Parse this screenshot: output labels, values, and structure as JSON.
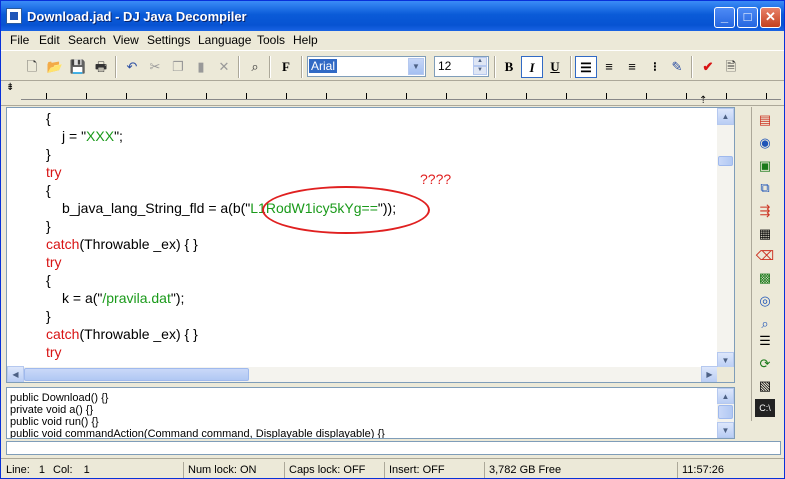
{
  "window": {
    "title": "Download.jad - DJ Java Decompiler"
  },
  "titlebar": {
    "minimize": "_",
    "maximize": "□",
    "close": "✕"
  },
  "menu": [
    "File",
    "Edit",
    "Search",
    "View",
    "Settings",
    "Language",
    "Tools",
    "Help"
  ],
  "toolbar": {
    "font_name": "Arial",
    "font_size": "12",
    "font_button": "F",
    "bold": "B",
    "italic": "I",
    "underline": "U"
  },
  "code": {
    "lines": [
      {
        "parts": [
          {
            "t": "{",
            "c": ""
          }
        ],
        "indent": 1
      },
      {
        "parts": [
          {
            "t": "j = \"",
            "c": ""
          },
          {
            "t": "XXX",
            "c": "str"
          },
          {
            "t": "\";",
            "c": ""
          }
        ],
        "indent": 2
      },
      {
        "parts": [
          {
            "t": "}",
            "c": ""
          }
        ],
        "indent": 1
      },
      {
        "parts": [
          {
            "t": "try",
            "c": "kw"
          }
        ],
        "indent": 1
      },
      {
        "parts": [
          {
            "t": "{",
            "c": ""
          }
        ],
        "indent": 1
      },
      {
        "parts": [
          {
            "t": "b_java_lang_String_fld = a(b(\"",
            "c": ""
          },
          {
            "t": "L1RodW1icy5kYg==",
            "c": "str"
          },
          {
            "t": "\"));",
            "c": ""
          }
        ],
        "indent": 2
      },
      {
        "parts": [
          {
            "t": "}",
            "c": ""
          }
        ],
        "indent": 1
      },
      {
        "parts": [
          {
            "t": "catch",
            "c": "kw"
          },
          {
            "t": "(Throwable _ex) { }",
            "c": ""
          }
        ],
        "indent": 1
      },
      {
        "parts": [
          {
            "t": "try",
            "c": "kw"
          }
        ],
        "indent": 1
      },
      {
        "parts": [
          {
            "t": "{",
            "c": ""
          }
        ],
        "indent": 1
      },
      {
        "parts": [
          {
            "t": "k = a(\"",
            "c": ""
          },
          {
            "t": "/pravila.dat",
            "c": "str"
          },
          {
            "t": "\");",
            "c": ""
          }
        ],
        "indent": 2
      },
      {
        "parts": [
          {
            "t": "}",
            "c": ""
          }
        ],
        "indent": 1
      },
      {
        "parts": [
          {
            "t": "catch",
            "c": "kw"
          },
          {
            "t": "(Throwable _ex) { }",
            "c": ""
          }
        ],
        "indent": 1
      },
      {
        "parts": [
          {
            "t": "try",
            "c": "kw"
          }
        ],
        "indent": 1
      }
    ],
    "annotation": "????"
  },
  "outline": [
    "public Download() {}",
    "private void a() {}",
    "public void run() {}",
    "public void commandAction(Command command, Displayable displayable) {}"
  ],
  "status": {
    "line_label": "Line:",
    "line": "1",
    "col_label": "Col:",
    "col": "1",
    "numlock": "Num lock: ON",
    "capslock": "Caps lock: OFF",
    "insert": "Insert: OFF",
    "free": "3,782 GB Free",
    "time": "11:57:26"
  }
}
